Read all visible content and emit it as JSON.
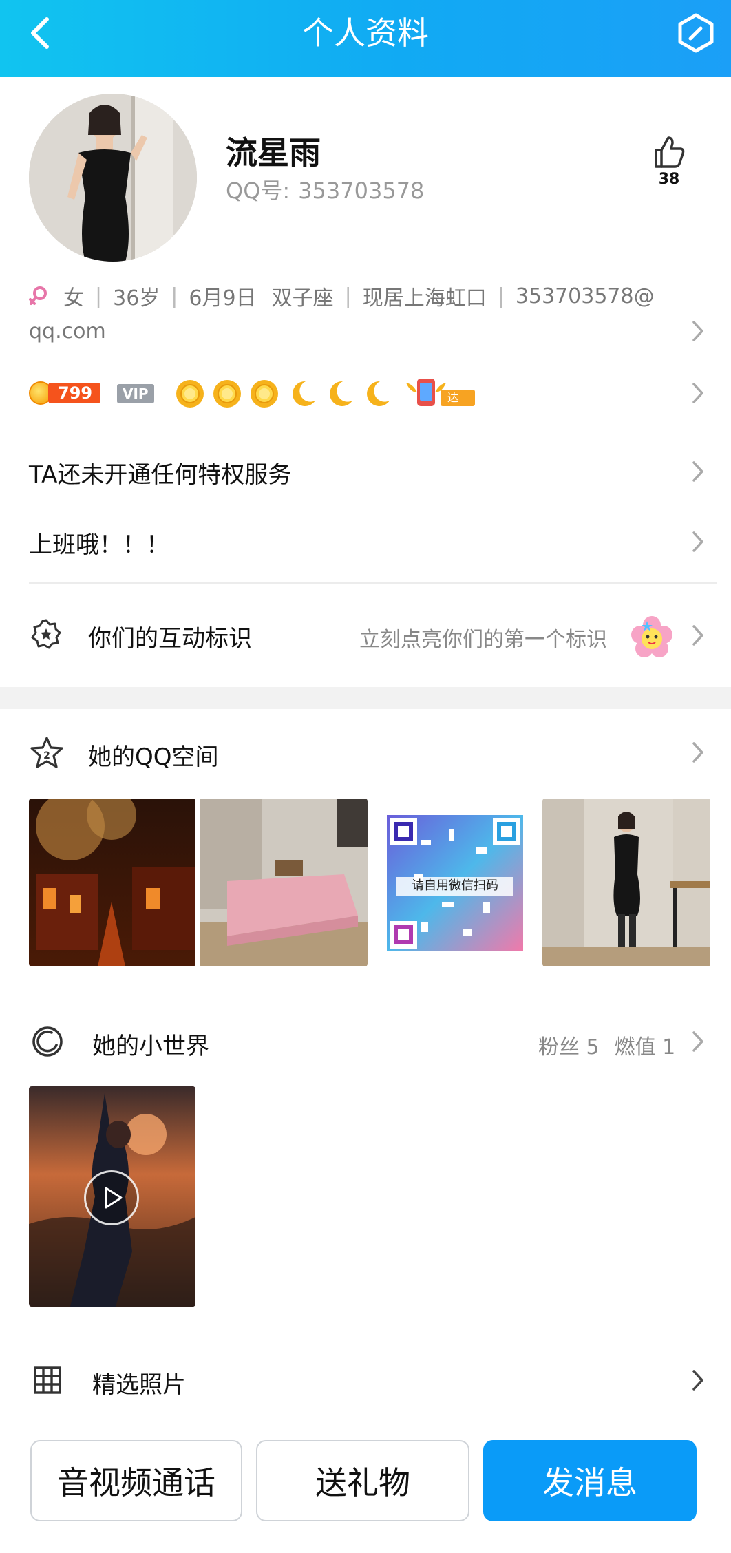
{
  "header": {
    "title": "个人资料"
  },
  "profile": {
    "name": "流星雨",
    "qq_label": "QQ号:",
    "qq_number": "353703578",
    "likes": "38",
    "gender": "女",
    "age": "36岁",
    "birthday": "6月9日",
    "zodiac": "双子座",
    "location": "现居上海虹口",
    "email_line1": "353703578@",
    "email_line2": "qq.com"
  },
  "level": {
    "coin_value": "799",
    "vip_label": "VIP",
    "expert_label": "达人"
  },
  "privilege_text": "TA还未开通任何特权服务",
  "signature": "上班哦！！！",
  "interaction": {
    "label": "你们的互动标识",
    "hint": "立刻点亮你们的第一个标识"
  },
  "qzone": {
    "title": "她的QQ空间",
    "qr_caption": "请自用微信扫码"
  },
  "small_world": {
    "title": "她的小世界",
    "fans": "粉丝 5",
    "burn": "燃值 1"
  },
  "featured": {
    "title": "精选照片"
  },
  "actions": {
    "call": "音视频通话",
    "gift": "送礼物",
    "message": "发消息"
  },
  "colors": {
    "header": "#11aaf3",
    "primary_button": "#0a9bf8",
    "badge_orange": "#f5531c",
    "gender_pink": "#e776a9"
  }
}
